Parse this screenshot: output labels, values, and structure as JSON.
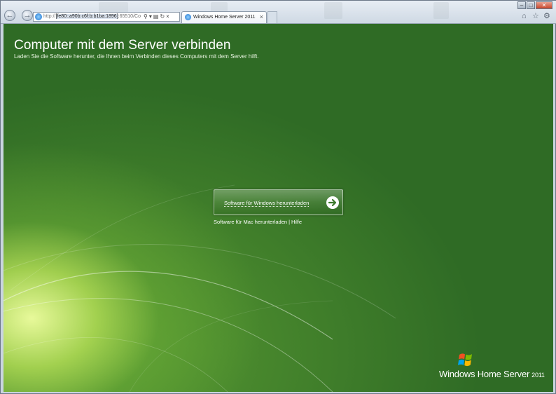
{
  "browser": {
    "address_scheme": "http://",
    "address_host": "[fe80::a90b:c6f:b:b1ba:1896]",
    "address_rest": ":65510/Co",
    "tab_title": "Windows Home Server 2011",
    "tab_close": "×",
    "icons": [
      "back-icon",
      "forward-icon",
      "search-icon",
      "refresh-icon",
      "home-icon",
      "favorites-star-icon",
      "tools-gear-icon"
    ]
  },
  "page": {
    "title": "Computer mit dem Server verbinden",
    "subtitle": "Laden Sie die Software herunter, die Ihnen beim Verbinden dieses Computers mit dem Server hilft.",
    "download_windows_label": "Software für Windows herunterladen",
    "download_mac_label": "Software für Mac herunterladen",
    "link_separator": "|",
    "help_label": "Hilfe"
  },
  "brand": {
    "name": "Windows Home Server",
    "year": "2011"
  },
  "colors": {
    "background_green": "#2f6b25",
    "highlight_green": "#d9f28a",
    "text": "#ffffff"
  }
}
